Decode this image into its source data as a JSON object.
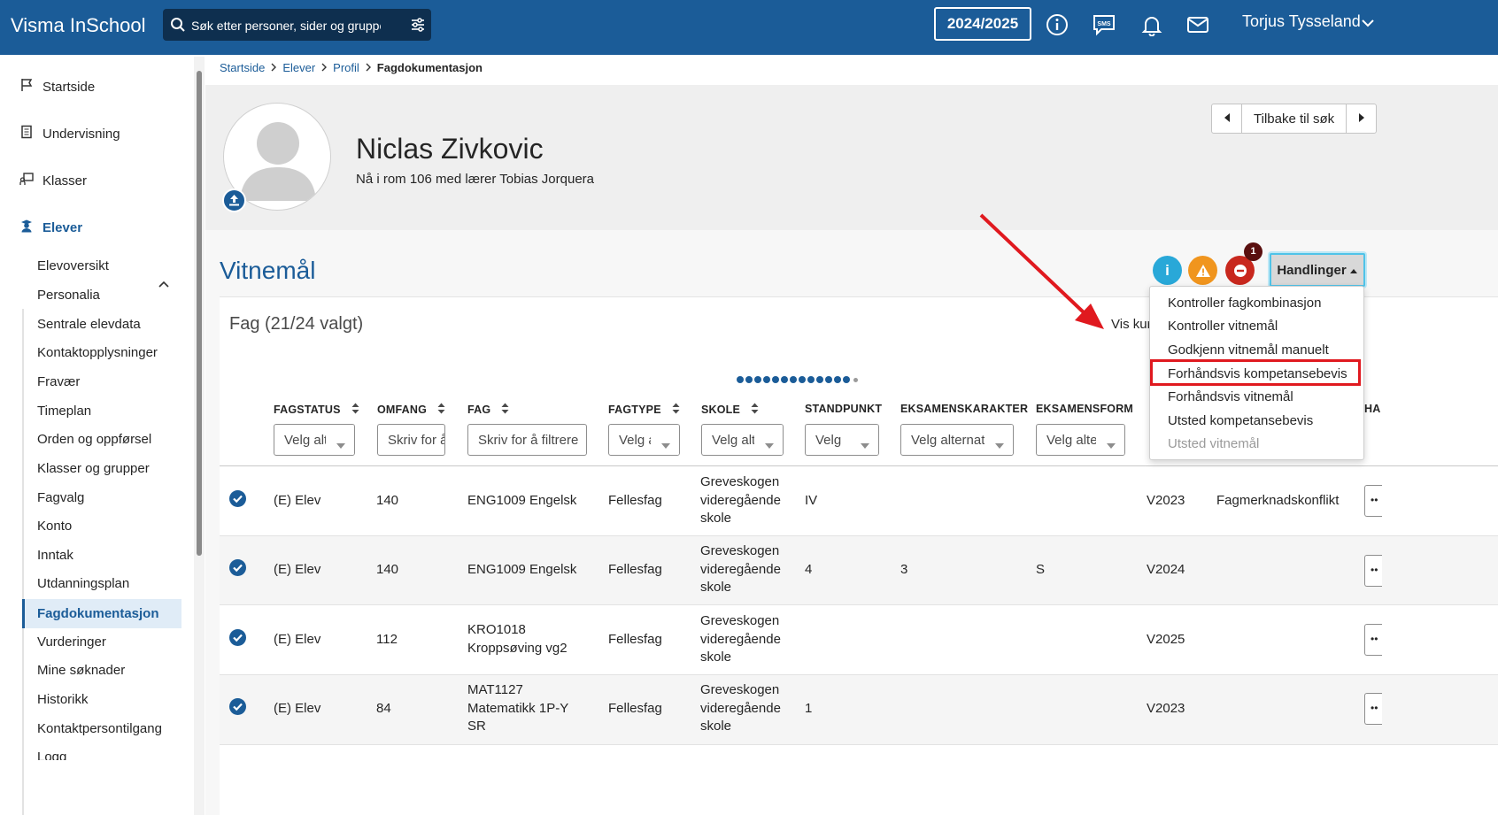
{
  "topbar": {
    "brand": "Visma InSchool",
    "search_placeholder": "Søk etter personer, sider og grupper",
    "school_year": "2024/2025",
    "user_name": "Torjus Tysseland",
    "icons": [
      "search-icon",
      "filter-icon",
      "info-icon",
      "sms-icon",
      "bell-icon",
      "mail-icon",
      "chevron-down-icon"
    ]
  },
  "sidebar": {
    "items": [
      {
        "label": "Startside",
        "icon": "flag-icon"
      },
      {
        "label": "Undervisning",
        "icon": "book-icon"
      },
      {
        "label": "Klasser",
        "icon": "classroom-icon"
      },
      {
        "label": "Elever",
        "icon": "student-icon"
      }
    ],
    "sub_items": [
      "Elevoversikt",
      "Personalia",
      "Sentrale elevdata",
      "Kontaktopplysninger",
      "Fravær",
      "Timeplan",
      "Orden og oppførsel",
      "Klasser og grupper",
      "Fagvalg",
      "Konto",
      "Inntak",
      "Utdanningsplan",
      "Fagdokumentasjon",
      "Vurderinger",
      "Mine søknader",
      "Historikk",
      "Kontaktpersontilgang",
      "Logg"
    ],
    "active_sub": "Fagdokumentasjon"
  },
  "breadcrumb": [
    "Startside",
    "Elever",
    "Profil",
    "Fagdokumentasjon"
  ],
  "student": {
    "name": "Niclas Zivkovic",
    "location": "Nå i rom 106 med lærer Tobias Jorquera"
  },
  "nav": {
    "back_label": "Tilbake til søk"
  },
  "section": {
    "title": "Vitnemål",
    "error_count": "1",
    "actions_label": "Handlinger",
    "status_colors": {
      "info": "#29a8d8",
      "warning": "#f0951e",
      "error": "#c8281e"
    }
  },
  "fag": {
    "title": "Fag (21/24 valgt)",
    "vis_label": "Vis kurs"
  },
  "table": {
    "columns": [
      {
        "label": "FAGSTATUS",
        "filter": "Velg alternativ"
      },
      {
        "label": "OMFANG",
        "filter": "Skriv for å filtrere"
      },
      {
        "label": "FAG",
        "filter": "Skriv for å filtrere"
      },
      {
        "label": "FAGTYPE",
        "filter": "Velg alternativ"
      },
      {
        "label": "SKOLE",
        "filter": "Velg alternativ"
      },
      {
        "label": "STANDPUNKT",
        "filter": "Velg"
      },
      {
        "label": "EKSAMENSKARAKTER",
        "filter": "Velg alternativ"
      },
      {
        "label": "EKSAMENSFORM",
        "filter": "Velg alternativ"
      },
      {
        "label": "HA",
        "filter": ""
      }
    ],
    "rows": [
      {
        "status": "(E) Elev",
        "omfang": "140",
        "fag": "ENG1009 Engelsk",
        "fagtype": "Fellesfag",
        "skole": "Greveskogen videregående skole",
        "standpunkt": "IV",
        "eksamenskarakter": "",
        "eksamensform": "",
        "termin": "V2023",
        "merknad": "Fagmerknadskonflikt"
      },
      {
        "status": "(E) Elev",
        "omfang": "140",
        "fag": "ENG1009 Engelsk",
        "fagtype": "Fellesfag",
        "skole": "Greveskogen videregående skole",
        "standpunkt": "4",
        "eksamenskarakter": "3",
        "eksamensform": "S",
        "termin": "V2024",
        "merknad": ""
      },
      {
        "status": "(E) Elev",
        "omfang": "112",
        "fag": "KRO1018 Kroppsøving vg2",
        "fagtype": "Fellesfag",
        "skole": "Greveskogen videregående skole",
        "standpunkt": "",
        "eksamenskarakter": "",
        "eksamensform": "",
        "termin": "V2025",
        "merknad": ""
      },
      {
        "status": "(E) Elev",
        "omfang": "84",
        "fag": "MAT1127 Matematikk 1P-Y SR",
        "fagtype": "Fellesfag",
        "skole": "Greveskogen videregående skole",
        "standpunkt": "1",
        "eksamenskarakter": "",
        "eksamensform": "",
        "termin": "V2023",
        "merknad": ""
      }
    ]
  },
  "menu": {
    "items": [
      {
        "label": "Kontroller fagkombinasjon",
        "disabled": false
      },
      {
        "label": "Kontroller vitnemål",
        "disabled": false
      },
      {
        "label": "Godkjenn vitnemål manuelt",
        "disabled": false
      },
      {
        "label": "Forhåndsvis kompetansebevis",
        "disabled": false
      },
      {
        "label": "Forhåndsvis vitnemål",
        "disabled": false
      },
      {
        "label": "Utsted kompetansebevis",
        "disabled": false
      },
      {
        "label": "Utsted vitnemål",
        "disabled": true
      }
    ],
    "highlighted": "Forhåndsvis kompetansebevis",
    "annotation_color": "#e0191f"
  }
}
